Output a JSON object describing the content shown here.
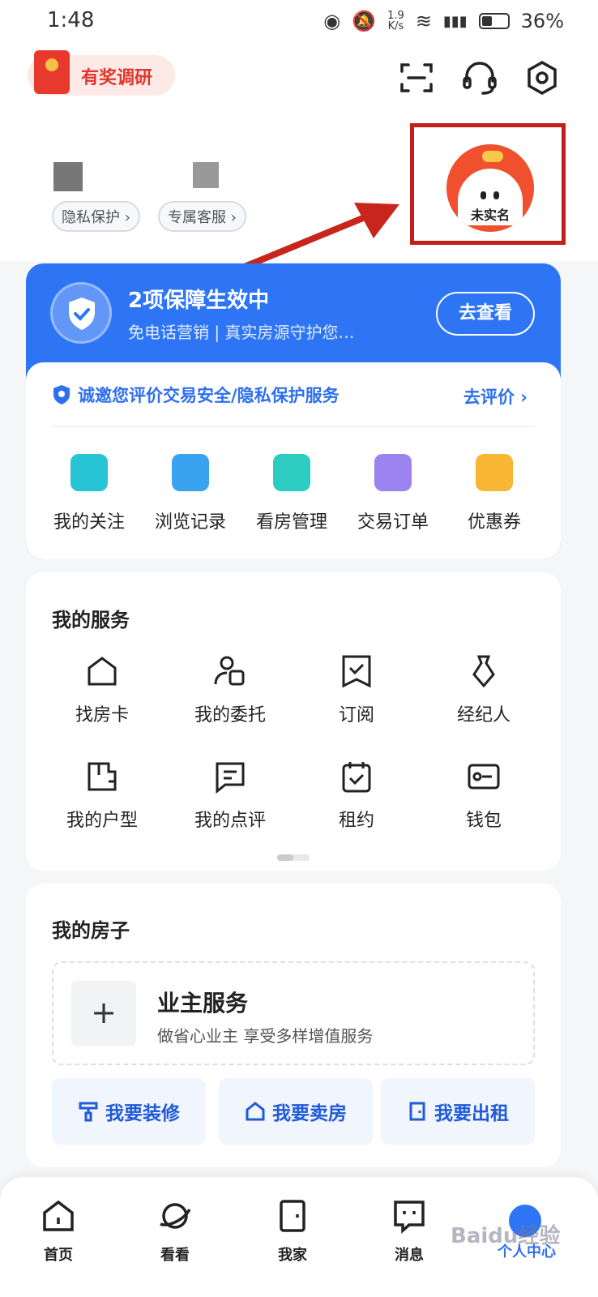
{
  "status_bar": {
    "time": "1:48",
    "net_speed_top": "1.9",
    "net_speed_bottom": "K/s",
    "battery": "36%"
  },
  "header": {
    "survey_label": "有奖调研",
    "pills": [
      "隐私保护 ›",
      "专属客服 ›"
    ],
    "avatar_label": "未实名"
  },
  "protection": {
    "title": "2项保障生效中",
    "subtitle": "免电话营销 | 真实房源守护您…",
    "button": "去查看",
    "evaluate_text": "诚邀您评价交易安全/隐私保护服务",
    "evaluate_link": "去评价 ›"
  },
  "quick_actions": [
    {
      "label": "我的关注",
      "color": "#27c4d6"
    },
    {
      "label": "浏览记录",
      "color": "#3aa3f0"
    },
    {
      "label": "看房管理",
      "color": "#2ccdc0"
    },
    {
      "label": "交易订单",
      "color": "#9b83f0"
    },
    {
      "label": "优惠券",
      "color": "#f7b733"
    }
  ],
  "services": {
    "title": "我的服务",
    "items": [
      {
        "label": "找房卡",
        "icon": "house-card-icon"
      },
      {
        "label": "我的委托",
        "icon": "entrust-icon"
      },
      {
        "label": "订阅",
        "icon": "subscribe-icon"
      },
      {
        "label": "经纪人",
        "icon": "agent-icon"
      },
      {
        "label": "我的户型",
        "icon": "floorplan-icon"
      },
      {
        "label": "我的点评",
        "icon": "comment-icon"
      },
      {
        "label": "租约",
        "icon": "lease-icon"
      },
      {
        "label": "钱包",
        "icon": "wallet-icon"
      }
    ]
  },
  "house": {
    "title": "我的房子",
    "owner_title": "业主服务",
    "owner_subtitle": "做省心业主 享受多样增值服务",
    "plus": "+",
    "buttons": [
      "我要装修",
      "我要卖房",
      "我要出租"
    ]
  },
  "nav": {
    "tabs": [
      "首页",
      "看看",
      "我家",
      "消息",
      "个人中心"
    ]
  },
  "watermark": "Baidu经验"
}
